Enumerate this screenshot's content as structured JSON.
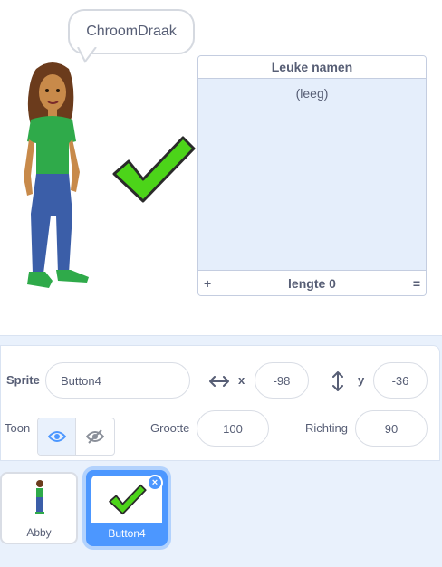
{
  "stage": {
    "speech_bubble": "ChroomDraak",
    "list": {
      "title": "Leuke namen",
      "empty_text": "(leeg)",
      "add_symbol": "+",
      "length_text": "lengte 0",
      "resize_symbol": "="
    }
  },
  "sprite_info": {
    "sprite_label": "Sprite",
    "sprite_name": "Button4",
    "x_label": "x",
    "x_value": "-98",
    "y_label": "y",
    "y_value": "-36",
    "show_label": "Toon",
    "size_label": "Grootte",
    "size_value": "100",
    "direction_label": "Richting",
    "direction_value": "90"
  },
  "sprites": [
    {
      "name": "Abby",
      "selected": false
    },
    {
      "name": "Button4",
      "selected": true
    }
  ],
  "colors": {
    "accent": "#4c97ff",
    "check_green": "#4cd419",
    "panel_bg": "#e9f1fc"
  }
}
